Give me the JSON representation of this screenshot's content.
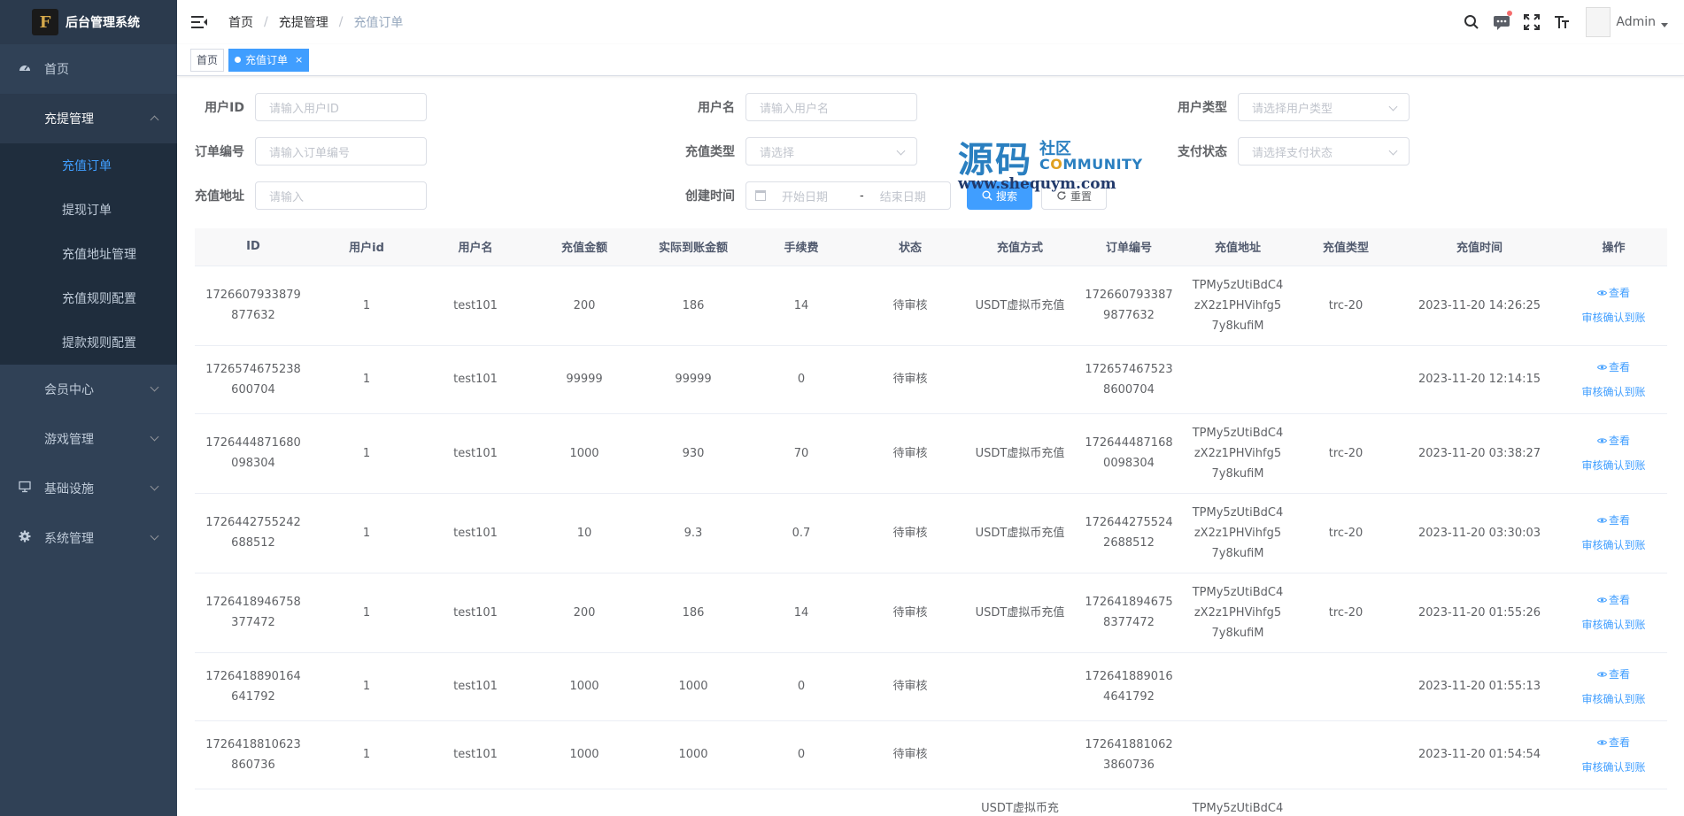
{
  "sidebar": {
    "logo_mark": "F",
    "title": "后台管理系统",
    "menu": [
      {
        "label": "首页",
        "icon": "dashboard-icon"
      },
      {
        "label": "充提管理",
        "icon": "none",
        "open": true,
        "children": [
          {
            "label": "充值订单",
            "active": true
          },
          {
            "label": "提现订单"
          },
          {
            "label": "充值地址管理"
          },
          {
            "label": "充值规则配置"
          },
          {
            "label": "提款规则配置"
          }
        ]
      },
      {
        "label": "会员中心",
        "icon": "none"
      },
      {
        "label": "游戏管理",
        "icon": "none"
      },
      {
        "label": "基础设施",
        "icon": "monitor-icon"
      },
      {
        "label": "系统管理",
        "icon": "gear-icon"
      }
    ]
  },
  "navbar": {
    "breadcrumb": [
      "首页",
      "充提管理",
      "充值订单"
    ],
    "user": "Admin"
  },
  "tags": [
    {
      "label": "首页"
    },
    {
      "label": "充值订单",
      "close": "×"
    }
  ],
  "filters": {
    "user_id": {
      "label": "用户ID",
      "placeholder": "请输入用户ID"
    },
    "username": {
      "label": "用户名",
      "placeholder": "请输入用户名"
    },
    "user_type": {
      "label": "用户类型",
      "placeholder": "请选择用户类型"
    },
    "order_no": {
      "label": "订单编号",
      "placeholder": "请输入订单编号"
    },
    "recharge_type": {
      "label": "充值类型",
      "placeholder": "请选择"
    },
    "pay_status": {
      "label": "支付状态",
      "placeholder": "请选择支付状态"
    },
    "address": {
      "label": "充值地址",
      "placeholder": "请输入"
    },
    "created": {
      "label": "创建时间",
      "start": "开始日期",
      "sep": "-",
      "end": "结束日期"
    },
    "search_btn": "搜索",
    "reset_btn": "重置"
  },
  "watermark": {
    "big": "源码",
    "cn": "社区",
    "en_pre": "C",
    "en_o": "O",
    "en_post": "MMUNITY",
    "url": "www.shequym.com"
  },
  "table": {
    "columns": [
      "ID",
      "用户id",
      "用户名",
      "充值金额",
      "实际到账金额",
      "手续费",
      "状态",
      "充值方式",
      "订单编号",
      "充值地址",
      "充值类型",
      "充值时间",
      "操作"
    ],
    "view_label": "查看",
    "confirm_label": "审核确认到账",
    "rows": [
      {
        "id": "1726607933879877632",
        "uid": "1",
        "name": "test101",
        "amount": "200",
        "actual": "186",
        "fee": "14",
        "status": "待审核",
        "method": "USDT虚拟币充值",
        "order": "1726607933879877632",
        "address": "TPMy5zUtiBdC4zX2z1PHVihfg57y8kufiM",
        "type": "trc-20",
        "time": "2023-11-20 14:26:25"
      },
      {
        "id": "1726574675238600704",
        "uid": "1",
        "name": "test101",
        "amount": "99999",
        "actual": "99999",
        "fee": "0",
        "status": "待审核",
        "method": "",
        "order": "1726574675238600704",
        "address": "",
        "type": "",
        "time": "2023-11-20 12:14:15"
      },
      {
        "id": "1726444871680098304",
        "uid": "1",
        "name": "test101",
        "amount": "1000",
        "actual": "930",
        "fee": "70",
        "status": "待审核",
        "method": "USDT虚拟币充值",
        "order": "1726444871680098304",
        "address": "TPMy5zUtiBdC4zX2z1PHVihfg57y8kufiM",
        "type": "trc-20",
        "time": "2023-11-20 03:38:27"
      },
      {
        "id": "1726442755242688512",
        "uid": "1",
        "name": "test101",
        "amount": "10",
        "actual": "9.3",
        "fee": "0.7",
        "status": "待审核",
        "method": "USDT虚拟币充值",
        "order": "1726442755242688512",
        "address": "TPMy5zUtiBdC4zX2z1PHVihfg57y8kufiM",
        "type": "trc-20",
        "time": "2023-11-20 03:30:03"
      },
      {
        "id": "1726418946758377472",
        "uid": "1",
        "name": "test101",
        "amount": "200",
        "actual": "186",
        "fee": "14",
        "status": "待审核",
        "method": "USDT虚拟币充值",
        "order": "1726418946758377472",
        "address": "TPMy5zUtiBdC4zX2z1PHVihfg57y8kufiM",
        "type": "trc-20",
        "time": "2023-11-20 01:55:26"
      },
      {
        "id": "1726418890164641792",
        "uid": "1",
        "name": "test101",
        "amount": "1000",
        "actual": "1000",
        "fee": "0",
        "status": "待审核",
        "method": "",
        "order": "1726418890164641792",
        "address": "",
        "type": "",
        "time": "2023-11-20 01:55:13"
      },
      {
        "id": "1726418810623860736",
        "uid": "1",
        "name": "test101",
        "amount": "1000",
        "actual": "1000",
        "fee": "0",
        "status": "待审核",
        "method": "",
        "order": "1726418810623860736",
        "address": "",
        "type": "",
        "time": "2023-11-20 01:54:54"
      },
      {
        "id": "",
        "uid": "",
        "name": "",
        "amount": "",
        "actual": "",
        "fee": "",
        "status": "",
        "method": "USDT虚拟币充",
        "order": "",
        "address": "TPMy5zUtiBdC4",
        "type": "",
        "time": ""
      }
    ]
  }
}
